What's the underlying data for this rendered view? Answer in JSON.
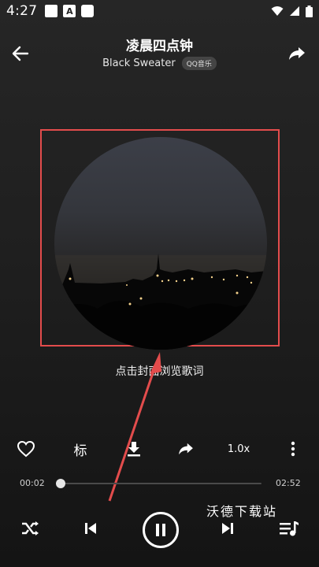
{
  "status_bar": {
    "time": "4:27",
    "notif_a": "A"
  },
  "header": {
    "title": "凌晨四点钟",
    "artist": "Black Sweater",
    "source_badge": "QQ音乐"
  },
  "lyrics_hint": "点击封面浏览歌词",
  "actions": {
    "tag_label": "标",
    "speed_label": "1.0x"
  },
  "progress": {
    "current": "00:02",
    "total": "02:52",
    "fraction": 0.012
  },
  "watermark": "沃德下载站",
  "colors": {
    "highlight_box": "#e34c4c",
    "arrow": "#e34c4c",
    "background": "#1f1f1f"
  }
}
